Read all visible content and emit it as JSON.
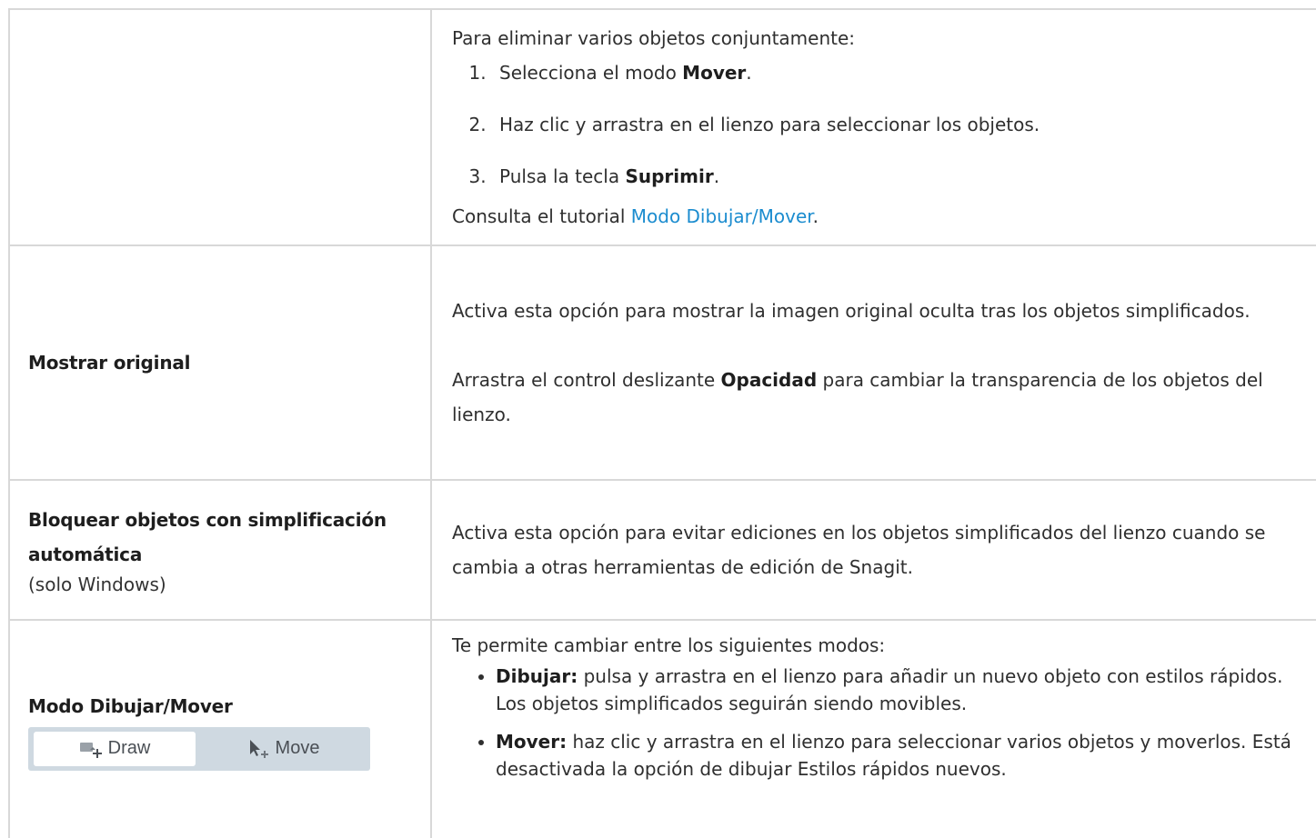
{
  "row1": {
    "intro": "Para eliminar varios objetos conjuntamente:",
    "steps": [
      {
        "num": "1.",
        "pre": "Selecciona el modo ",
        "bold": "Mover",
        "post": "."
      },
      {
        "num": "2.",
        "text": "Haz clic y arrastra en el lienzo para seleccionar los objetos."
      },
      {
        "num": "3.",
        "pre": "Pulsa la tecla ",
        "bold": "Suprimir",
        "post": "."
      }
    ],
    "tutorial_pre": "Consulta el tutorial ",
    "tutorial_link": "Modo Dibujar/Mover",
    "tutorial_post": "."
  },
  "row2": {
    "label": "Mostrar original",
    "p1": "Activa esta opción para mostrar la imagen original oculta tras los objetos simplificados.",
    "p2_pre": "Arrastra el control deslizante ",
    "p2_bold": "Opacidad",
    "p2_post": " para cambiar la transparencia de los objetos del lienzo."
  },
  "row3": {
    "label": "Bloquear objetos con simplificación automática",
    "sublabel": "(solo Windows)",
    "text": "Activa esta opción para evitar ediciones en los objetos simplificados del lienzo cuando se cambia a otras herramientas de edición de Snagit."
  },
  "row4": {
    "label": "Modo Dibujar/Mover",
    "toggle": {
      "draw_label": "Draw",
      "move_label": "Move",
      "draw_icon": "draw-shape-plus-icon",
      "move_icon": "cursor-move-icon",
      "selected": "Draw"
    },
    "intro": "Te permite cambiar entre los siguientes modos:",
    "modes": [
      {
        "bold": "Dibujar:",
        "text": " pulsa y arrastra en el lienzo para añadir un nuevo objeto con estilos rápidos. Los objetos simplificados seguirán siendo movibles."
      },
      {
        "bold": "Mover:",
        "text": " haz clic y arrastra en el lienzo para seleccionar varios objetos y moverlos. Está desactivada la opción de dibujar Estilos rápidos nuevos."
      }
    ]
  },
  "colors": {
    "link": "#1b8ccf",
    "border": "#d8d8d8",
    "toggle_bg": "#cfd9e1"
  }
}
